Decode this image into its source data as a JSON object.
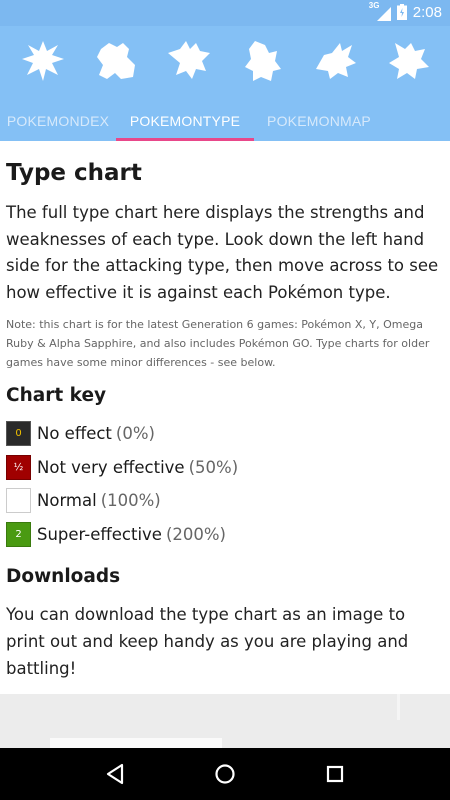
{
  "status_bar": {
    "network": "3G",
    "time": "2:08",
    "bg_color": "#7cb8f0"
  },
  "header": {
    "bg_color": "#84c0f5",
    "icons": [
      "pokemon-silhouette-icon",
      "pokemon-silhouette-icon",
      "pokemon-silhouette-icon",
      "pokemon-silhouette-icon",
      "pokemon-silhouette-icon",
      "pokemon-silhouette-icon"
    ]
  },
  "tabs": [
    {
      "label": "POKEMONDEX",
      "active": false
    },
    {
      "label": "POKEMONTYPE",
      "active": true
    },
    {
      "label": "POKEMONMAP",
      "active": false
    }
  ],
  "accent_color": "#e8488a",
  "content": {
    "title": "Type chart",
    "lead": "The full type chart here displays the strengths and weaknesses of each type. Look down the left hand side for the attacking type, then move across to see how effective it is against each Pokémon type.",
    "note": "Note: this chart is for the latest Generation 6 games: Pokémon X, Y, Omega Ruby & Alpha Sapphire, and also includes Pokémon GO. Type charts for older games have some minor differences - see below.",
    "chart_key_title": "Chart key",
    "key": [
      {
        "symbol": "0",
        "label": "No effect",
        "pct": "(0%)",
        "color": "#2a2a2a"
      },
      {
        "symbol": "½",
        "label": "Not very effective",
        "pct": "(50%)",
        "color": "#a00000"
      },
      {
        "symbol": "",
        "label": "Normal",
        "pct": "(100%)",
        "color": "#ffffff"
      },
      {
        "symbol": "2",
        "label": "Super-effective",
        "pct": "(200%)",
        "color": "#4a9a12"
      }
    ],
    "downloads_title": "Downloads",
    "downloads_text": "You can download the type chart as an image to print out and keep handy as you are playing and battling!"
  },
  "nav": {
    "buttons": [
      "back-icon",
      "home-icon",
      "recents-icon"
    ]
  }
}
